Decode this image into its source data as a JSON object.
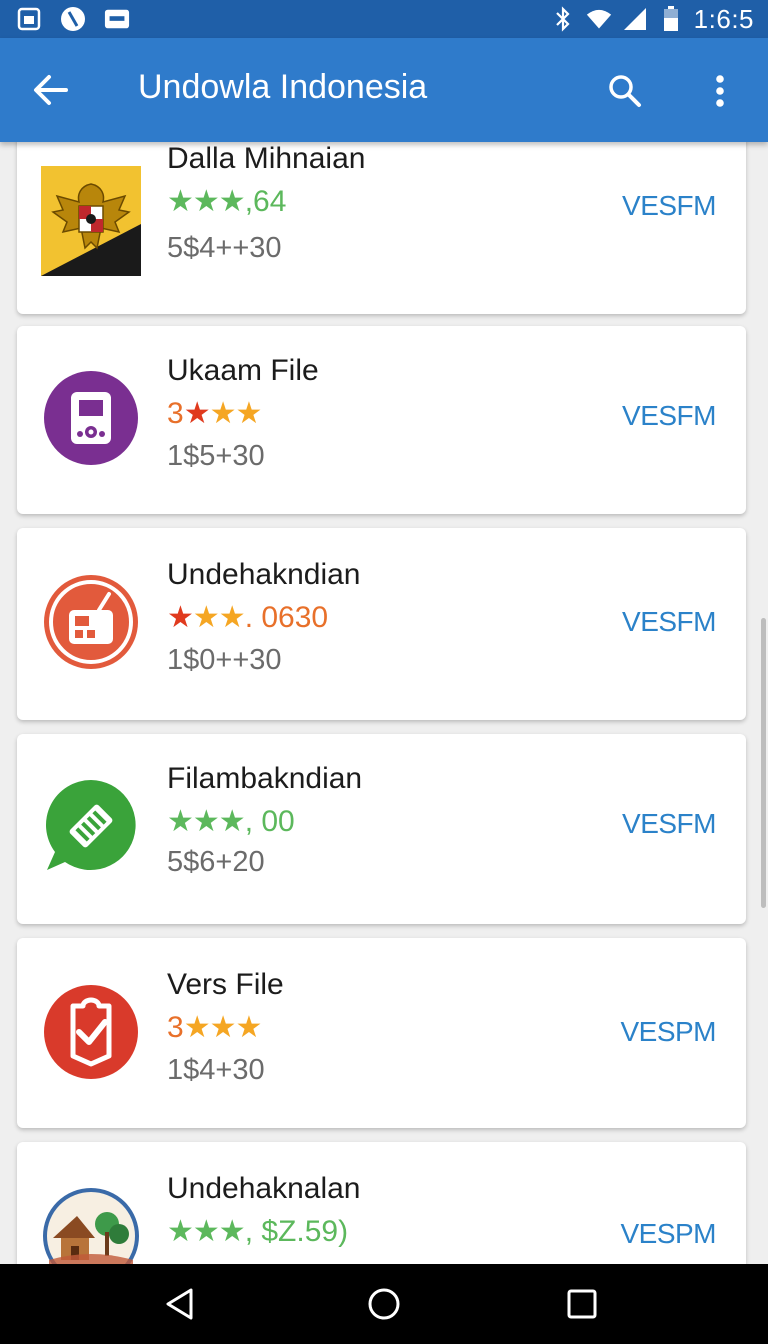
{
  "status_bar": {
    "time": "1:6:5",
    "icons": [
      "gallery-icon",
      "blocked-icon",
      "cast-icon",
      "bluetooth-icon",
      "wifi-icon",
      "signal-icon",
      "battery-icon"
    ]
  },
  "app_bar": {
    "title": "Undowla Indonesia",
    "back_icon": "arrow-left-icon",
    "search_icon": "search-icon",
    "more_icon": "more-vert-icon"
  },
  "apps": [
    {
      "name": "Dalla Mihnaian",
      "rating_prefix": "",
      "stars": "★★★",
      "rating_suffix": ",64",
      "star_color": "#5cb85c",
      "suffix_color": "#5cb85c",
      "meta": "5$4++30",
      "action": "VESFM",
      "icon": "garuda-emblem-icon"
    },
    {
      "name": "Ukaam File",
      "rating_prefix": "3",
      "stars": "★★★",
      "rating_suffix": "",
      "star_color": "#f5a623",
      "suffix_color": "#e8702a",
      "meta": "1$5+30",
      "action": "VESFM",
      "icon": "music-player-icon"
    },
    {
      "name": "Undehakndian",
      "rating_prefix": "",
      "stars": "★★★",
      "rating_suffix": ". 0630",
      "star_color": "#f5a623",
      "suffix_color": "#e8702a",
      "meta": "1$0++30",
      "action": "VESFM",
      "icon": "radio-icon"
    },
    {
      "name": "Filambakndian",
      "rating_prefix": "",
      "stars": "★★★",
      "rating_suffix": ", 00",
      "star_color": "#5cb85c",
      "suffix_color": "#5cb85c",
      "meta": "5$6+20",
      "action": "VESFM",
      "icon": "chat-file-icon"
    },
    {
      "name": "Vers File",
      "rating_prefix": "3",
      "stars": "★★★",
      "rating_suffix": "",
      "star_color": "#f5a623",
      "suffix_color": "#e8702a",
      "meta": "1$4+30",
      "action": "VESPM",
      "icon": "clipboard-check-icon"
    },
    {
      "name": "Undehaknalan",
      "rating_prefix": "",
      "stars": "★★★",
      "rating_suffix": ", $Z.59)",
      "star_color": "#5cb85c",
      "suffix_color": "#5cb85c",
      "meta": "",
      "action": "VESPM",
      "icon": "village-illustration-icon"
    }
  ],
  "nav_bar": {
    "back": "nav-back-icon",
    "home": "nav-home-icon",
    "recents": "nav-recents-icon"
  }
}
